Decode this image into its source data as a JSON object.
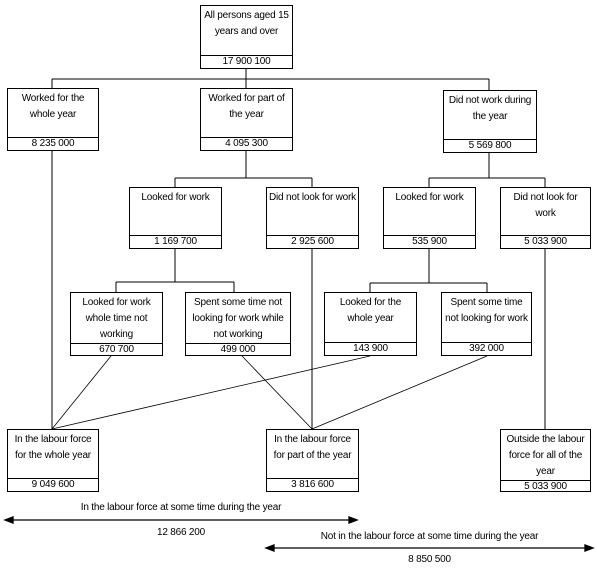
{
  "diagram": {
    "nodes": {
      "root": {
        "label": "All persons aged 15 years and over",
        "value": "17 900 100"
      },
      "worked_whole": {
        "label": "Worked for the whole year",
        "value": "8 235 000"
      },
      "worked_part": {
        "label": "Worked for part of the year",
        "value": "4 095 300"
      },
      "did_not_work": {
        "label": "Did not work during the year",
        "value": "5 569 800"
      },
      "part_looked": {
        "label": "Looked for work",
        "value": "1 169 700"
      },
      "part_not_looked": {
        "label": "Did not look for work",
        "value": "2 925 600"
      },
      "dnw_looked": {
        "label": "Looked for work",
        "value": "535 900"
      },
      "dnw_not_looked": {
        "label": "Did not look for work",
        "value": "5 033 900"
      },
      "looked_whole_time": {
        "label": "Looked for work whole time not working",
        "value": "670 700"
      },
      "spent_some_time_part": {
        "label": "Spent some time not looking for work while not working",
        "value": "499 000"
      },
      "looked_whole_year": {
        "label": "Looked for the whole year",
        "value": "143 900"
      },
      "spent_some_time_dnw": {
        "label": "Spent some time not looking for work",
        "value": "392 000"
      },
      "lf_whole_year": {
        "label": "In the labour force for the whole year",
        "value": "9 049 600"
      },
      "lf_part_year": {
        "label": "In the labour force for part of the year",
        "value": "3 816 600"
      },
      "outside_lf": {
        "label": "Outside the labour force for all of the year",
        "value": "5 033 900"
      }
    },
    "spans": {
      "in_lf": {
        "label": "In the labour force at some time during the year",
        "value": "12 866 200"
      },
      "not_in_lf": {
        "label": "Not in the labour force at some time during the year",
        "value": "8 850 500"
      }
    }
  }
}
